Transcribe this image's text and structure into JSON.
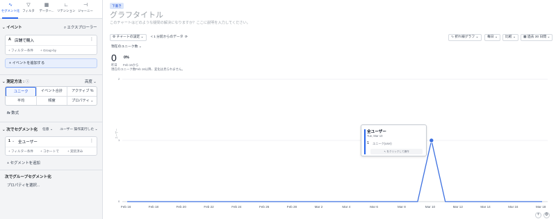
{
  "left_panel": {
    "tabs": [
      {
        "label": "セグメント化",
        "icon": "line-chart-icon"
      },
      {
        "label": "フィルタ",
        "icon": "filter-icon"
      },
      {
        "label": "データー...",
        "icon": "table-icon"
      },
      {
        "label": "リテンション",
        "icon": "retention-icon"
      },
      {
        "label": "ジャーニー",
        "icon": "journey-icon"
      }
    ],
    "events_header": "イベント",
    "explorer": "エクスプローラー",
    "event": {
      "letter": "A",
      "name": "店舗で購入",
      "filter": "+ フィルター条件",
      "groupby": "+ Group-by"
    },
    "add_event": "+ イベントを追加する",
    "measure_label": "測定方法 :",
    "advanced": "高度",
    "measure_options": [
      "ユニーク",
      "イベント合計",
      "アクティブ %",
      "平均",
      "頻度",
      "プロパティ"
    ],
    "formula": "数式",
    "segment_header": "次でセグメント化",
    "segment_any": "任意",
    "segment_performed": "ユーザー 操作実行した",
    "segment": {
      "number": "1",
      "name": "全ユーザー",
      "filter": "+ フィルター条件",
      "cohort": "+ コホートで",
      "performed": "+ 実装済み"
    },
    "add_segment": "+ セグメントを追加",
    "group_header": "次でグループセグメント化",
    "select_property": "プロパティを選択..."
  },
  "main": {
    "badge": "下書き",
    "title": "グラフタイトル",
    "description": "このチャートはどのような疑問の解決になりますか？ここに説明を入力してください。",
    "toolbar": {
      "settings": "チャートの設定",
      "data_latency": "< 1 分前からのデータ",
      "chart_type": "折れ線グラフ",
      "interval": "毎日",
      "compare": "比較",
      "range": "過去 30 日間"
    },
    "metric_selector": "現在のユニーク数",
    "summary": {
      "value": "0",
      "period": "昨日",
      "change": "0%",
      "from": "Feb 16から",
      "note": "現在のユニーク数Feb 16以降、変化は見られません。"
    }
  },
  "chart_data": {
    "type": "line",
    "x": [
      "Feb 16",
      "Feb 17",
      "Feb 18",
      "Feb 19",
      "Feb 20",
      "Feb 21",
      "Feb 22",
      "Feb 23",
      "Feb 24",
      "Feb 25",
      "Feb 26",
      "Feb 27",
      "Feb 28",
      "Mar 1",
      "Mar 2",
      "Mar 3",
      "Mar 4",
      "Mar 5",
      "Mar 6",
      "Mar 7",
      "Mar 8",
      "Mar 9",
      "Mar 10",
      "Mar 11",
      "Mar 12",
      "Mar 13",
      "Mar 14",
      "Mar 15",
      "Mar 16",
      "Mar 17",
      "Mar 18"
    ],
    "x_ticks": [
      "Feb 16",
      "Feb 18",
      "Feb 20",
      "Feb 22",
      "Feb 24",
      "Feb 26",
      "Feb 28",
      "Mar 2",
      "Mar 4",
      "Mar 6",
      "Mar 8",
      "Mar 10",
      "Mar 12",
      "Mar 14",
      "Mar 16",
      "Mar 18"
    ],
    "series": [
      {
        "name": "全ユーザー",
        "values": [
          0,
          0,
          0,
          0,
          0,
          0,
          0,
          0,
          0,
          0,
          0,
          0,
          0,
          0,
          0,
          0,
          0,
          0,
          0,
          0,
          0,
          0,
          1,
          0,
          0,
          0,
          0,
          0,
          0,
          0,
          0
        ],
        "color": "#3b6fe0"
      }
    ],
    "y_ticks": [
      "0",
      "1",
      "2"
    ],
    "ylim": [
      0,
      2
    ],
    "ylabel": "ユーザー",
    "grid": true,
    "tooltip": {
      "title": "全ユーザー",
      "date": "Tue, Mar 10",
      "value": "1",
      "unit": "ユニーク(user)",
      "hint": "をクリックして操作"
    }
  }
}
